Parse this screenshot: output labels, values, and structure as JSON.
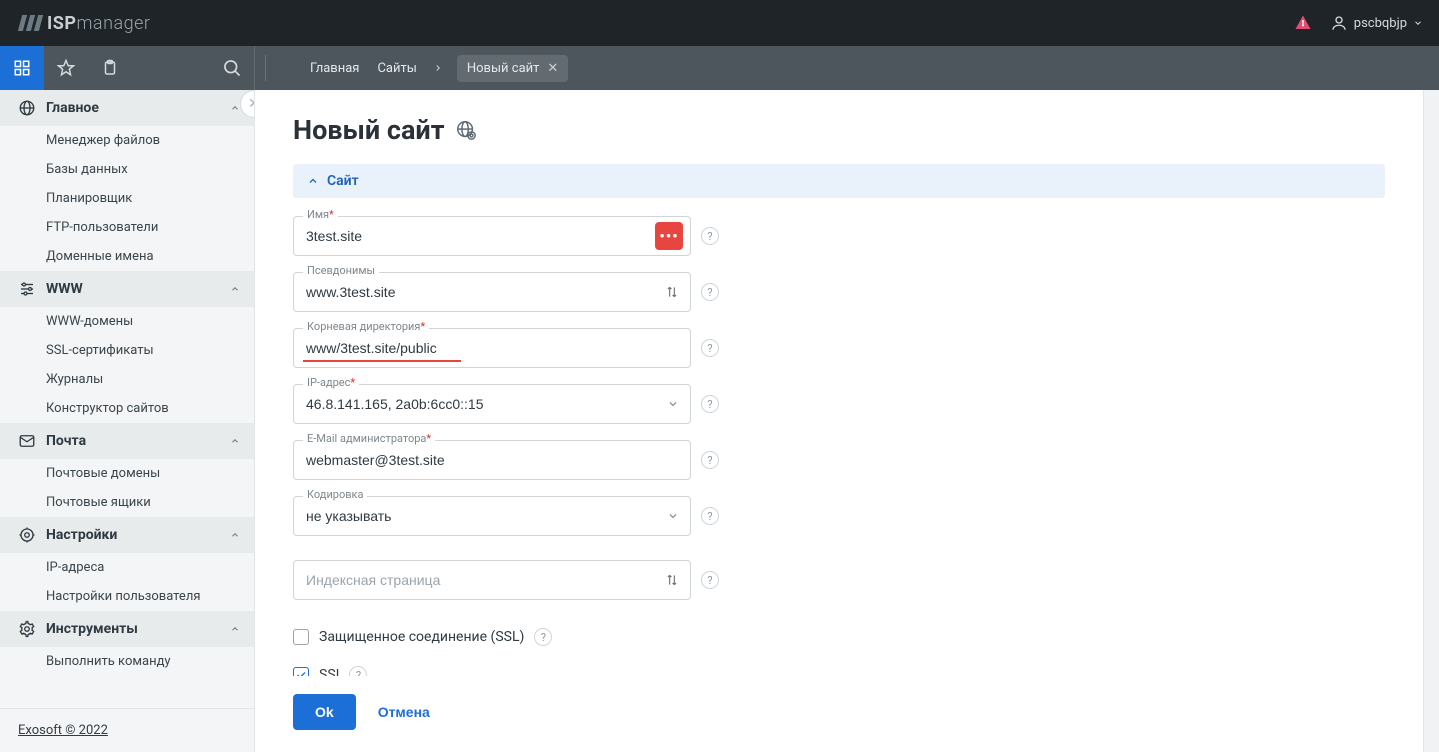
{
  "brand": {
    "name": "manager",
    "prefix": "ISP"
  },
  "header": {
    "username": "pscbqbjp"
  },
  "breadcrumbs": {
    "home": "Главная",
    "sites": "Сайты",
    "current": "Новый сайт"
  },
  "sidebar": {
    "footer_link": "Exosoft © 2022",
    "groups": [
      {
        "label": "Главное",
        "key": "main",
        "items": [
          "Менеджер файлов",
          "Базы данных",
          "Планировщик",
          "FTP-пользователи",
          "Доменные имена"
        ]
      },
      {
        "label": "WWW",
        "key": "www",
        "items": [
          "WWW-домены",
          "SSL-сертификаты",
          "Журналы",
          "Конструктор сайтов"
        ]
      },
      {
        "label": "Почта",
        "key": "mail",
        "items": [
          "Почтовые домены",
          "Почтовые ящики"
        ]
      },
      {
        "label": "Настройки",
        "key": "settings",
        "items": [
          "IP-адреса",
          "Настройки пользователя"
        ]
      },
      {
        "label": "Инструменты",
        "key": "tools",
        "items": [
          "Выполнить команду"
        ]
      }
    ]
  },
  "page": {
    "title": "Новый сайт",
    "section_title": "Сайт",
    "fields": {
      "name_label": "Имя",
      "name_value": "3test.site",
      "aliases_label": "Псевдонимы",
      "aliases_value": "www.3test.site",
      "root_label": "Корневая директория",
      "root_value": "www/3test.site/public",
      "ip_label": "IP-адрес",
      "ip_value": "46.8.141.165, 2a0b:6cc0::15",
      "email_label": "E-Mail администратора",
      "email_value": "webmaster@3test.site",
      "encoding_label": "Кодировка",
      "encoding_value": "не указывать",
      "index_placeholder": "Индексная страница",
      "ssl_label": "Защищенное соединение (SSL)",
      "ssi_label": "SSI",
      "ssi_checked": true,
      "ssl_checked": false
    },
    "actions": {
      "ok": "Ok",
      "cancel": "Отмена"
    }
  }
}
